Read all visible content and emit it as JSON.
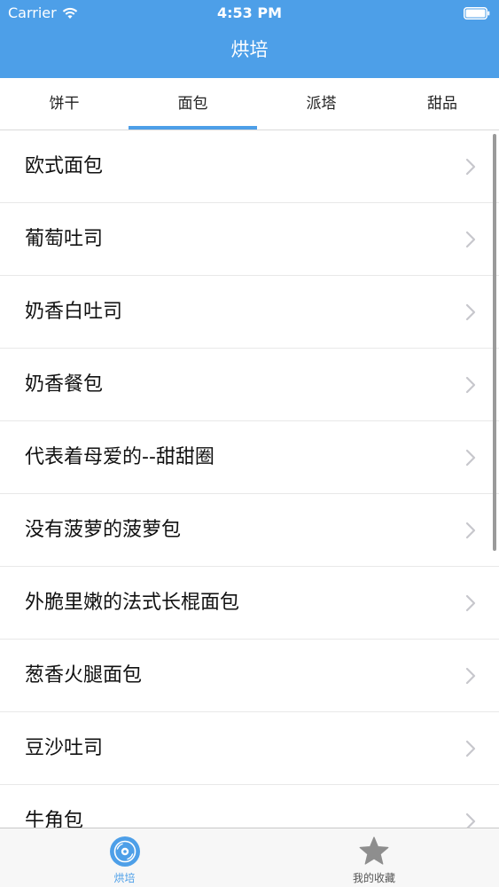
{
  "colors": {
    "accent": "#4d9fe8",
    "divider": "#e8e8e8",
    "chevron": "#c7c7cc",
    "inactive_icon": "#8e8e8e"
  },
  "status_bar": {
    "carrier": "Carrier",
    "time": "4:53 PM",
    "wifi_icon": "wifi-icon",
    "battery_icon": "battery-icon"
  },
  "nav": {
    "title": "烘培"
  },
  "tabs": [
    {
      "label": "饼干",
      "active": false
    },
    {
      "label": "面包",
      "active": true
    },
    {
      "label": "派塔",
      "active": false
    },
    {
      "label": "甜品",
      "active": false
    }
  ],
  "list": {
    "items": [
      {
        "label": "欧式面包"
      },
      {
        "label": "葡萄吐司"
      },
      {
        "label": "奶香白吐司"
      },
      {
        "label": "奶香餐包"
      },
      {
        "label": "代表着母爱的--甜甜圈"
      },
      {
        "label": "没有菠萝的菠萝包"
      },
      {
        "label": "外脆里嫩的法式长棍面包"
      },
      {
        "label": "葱香火腿面包"
      },
      {
        "label": "豆沙吐司"
      },
      {
        "label": "牛角包"
      }
    ],
    "chevron_icon": "chevron-right-icon"
  },
  "tabbar": [
    {
      "label": "烘培",
      "icon": "disc-icon",
      "active": true
    },
    {
      "label": "我的收藏",
      "icon": "star-icon",
      "active": false
    }
  ]
}
